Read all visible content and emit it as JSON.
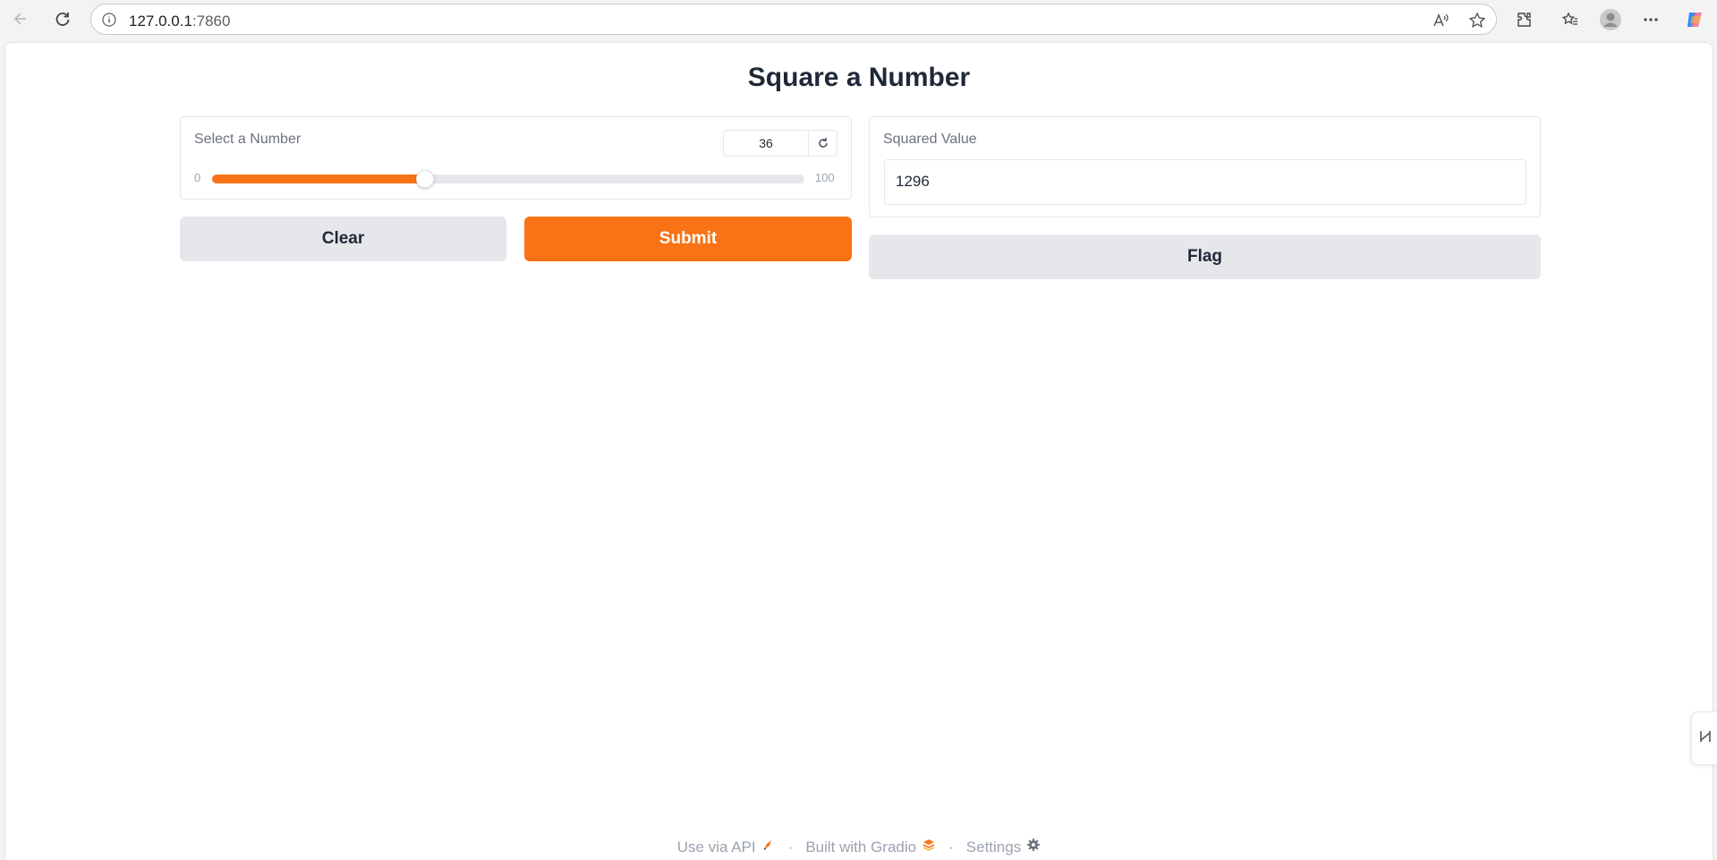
{
  "browser": {
    "url_host": "127.0.0.1",
    "url_port": ":7860"
  },
  "page": {
    "title": "Square a Number"
  },
  "slider": {
    "label": "Select a Number",
    "value": "36",
    "min_label": "0",
    "max_label": "100",
    "fraction": 0.36
  },
  "buttons": {
    "clear": "Clear",
    "submit": "Submit",
    "flag": "Flag"
  },
  "output": {
    "label": "Squared Value",
    "value": "1296"
  },
  "footer": {
    "api": "Use via API",
    "built": "Built with Gradio",
    "settings": "Settings",
    "separator": "·"
  },
  "colors": {
    "accent": "#f97316",
    "secondary": "#e5e7eb"
  }
}
